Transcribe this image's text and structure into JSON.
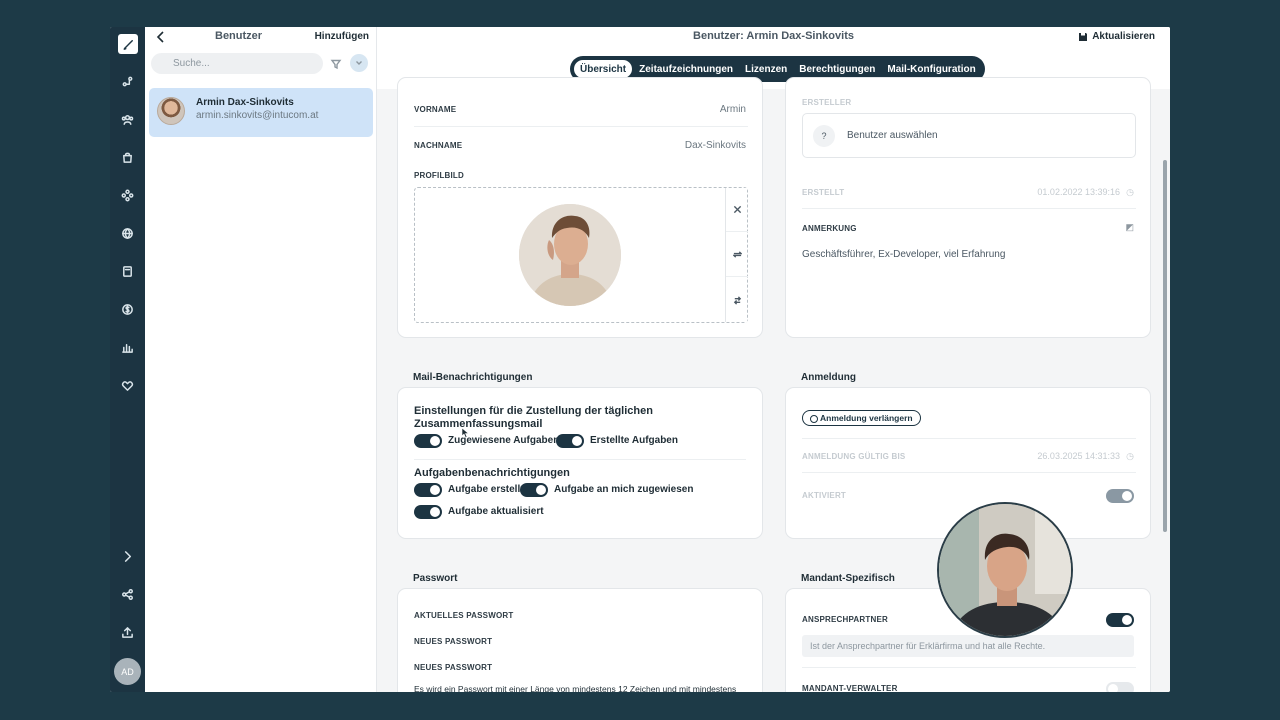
{
  "rail": {
    "items": [
      "pen",
      "workflow",
      "users",
      "bag",
      "modules",
      "globe",
      "book",
      "dollar",
      "chart",
      "heart"
    ],
    "bottom": [
      "chevron-right",
      "share",
      "upload"
    ],
    "avatar_initials": "AD"
  },
  "list": {
    "title": "Benutzer",
    "add_label": "Hinzufügen",
    "search_placeholder": "Suche...",
    "selected_user": {
      "name": "Armin Dax-Sinkovits",
      "email": "armin.sinkovits@intucom.at"
    }
  },
  "header": {
    "title": "Benutzer: Armin Dax-Sinkovits",
    "refresh_label": "Aktualisieren",
    "tabs": [
      "Übersicht",
      "Zeitaufzeichnungen",
      "Lizenzen",
      "Berechtigungen",
      "Mail-Konfiguration"
    ],
    "active_tab": "Übersicht"
  },
  "profile": {
    "first_name_label": "VORNAME",
    "first_name": "Armin",
    "last_name_label": "NACHNAME",
    "last_name": "Dax-Sinkovits",
    "photo_label": "PROFILBILD"
  },
  "meta": {
    "creator_label": "ERSTELLER",
    "creator_placeholder": "Benutzer auswählen",
    "created_label": "ERSTELLT",
    "created_value": "01.02.2022 13:39:16",
    "note_label": "ANMERKUNG",
    "note_value": "Geschäftsführer, Ex-Developer, viel Erfahrung"
  },
  "mail": {
    "section_title": "Mail-Benachrichtigungen",
    "summary_heading": "Einstellungen für die Zustellung der täglichen Zusammenfassungsmail",
    "summary_toggles": [
      {
        "label": "Zugewiesene Aufgaben",
        "on": true
      },
      {
        "label": "Erstellte Aufgaben",
        "on": true
      }
    ],
    "task_heading": "Aufgabenbenachrichtigungen",
    "task_toggles": [
      {
        "label": "Aufgabe erstellt",
        "on": true
      },
      {
        "label": "Aufgabe an mich zugewiesen",
        "on": true
      },
      {
        "label": "Aufgabe aktualisiert",
        "on": true
      }
    ]
  },
  "login": {
    "section_title": "Anmeldung",
    "extend_label": "Anmeldung verlängern",
    "valid_until_label": "ANMELDUNG GÜLTIG BIS",
    "valid_until_value": "26.03.2025 14:31:33",
    "active_label": "AKTIVIERT",
    "active": true
  },
  "password": {
    "section_title": "Passwort",
    "current_label": "AKTUELLES PASSWORT",
    "new_label": "NEUES PASSWORT",
    "repeat_label": "NEUES PASSWORT",
    "hint": "Es wird ein Passwort mit einer Länge von mindestens 12 Zeichen und mit mindestens"
  },
  "tenant": {
    "section_title": "Mandant-Spezifisch",
    "contact_label": "ANSPRECHPARTNER",
    "contact_on": true,
    "contact_hint": "Ist der Ansprechpartner für Erklärfirma und hat alle Rechte.",
    "admin_label": "MANDANT-VERWALTER",
    "admin_on": false
  }
}
